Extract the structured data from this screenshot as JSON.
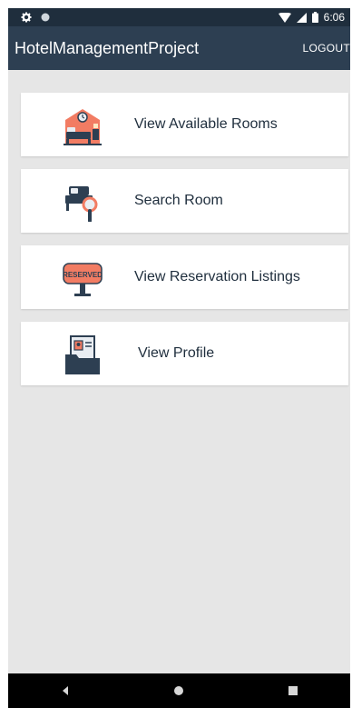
{
  "status_bar": {
    "time": "6:06"
  },
  "app_bar": {
    "title": "HotelManagementProject",
    "logout_label": "LOGOUT"
  },
  "menu": {
    "items": [
      {
        "label": "View Available Rooms",
        "icon": "hotel-room-icon"
      },
      {
        "label": "Search Room",
        "icon": "search-room-icon"
      },
      {
        "label": "View Reservation Listings",
        "icon": "reserved-sign-icon",
        "icon_text": "RESERVED"
      },
      {
        "label": "View Profile",
        "icon": "profile-folder-icon"
      }
    ]
  },
  "colors": {
    "status_bar": "#1f2e3d",
    "app_bar": "#2d3f52",
    "background": "#e6e6e6",
    "accent": "#f27c63"
  }
}
